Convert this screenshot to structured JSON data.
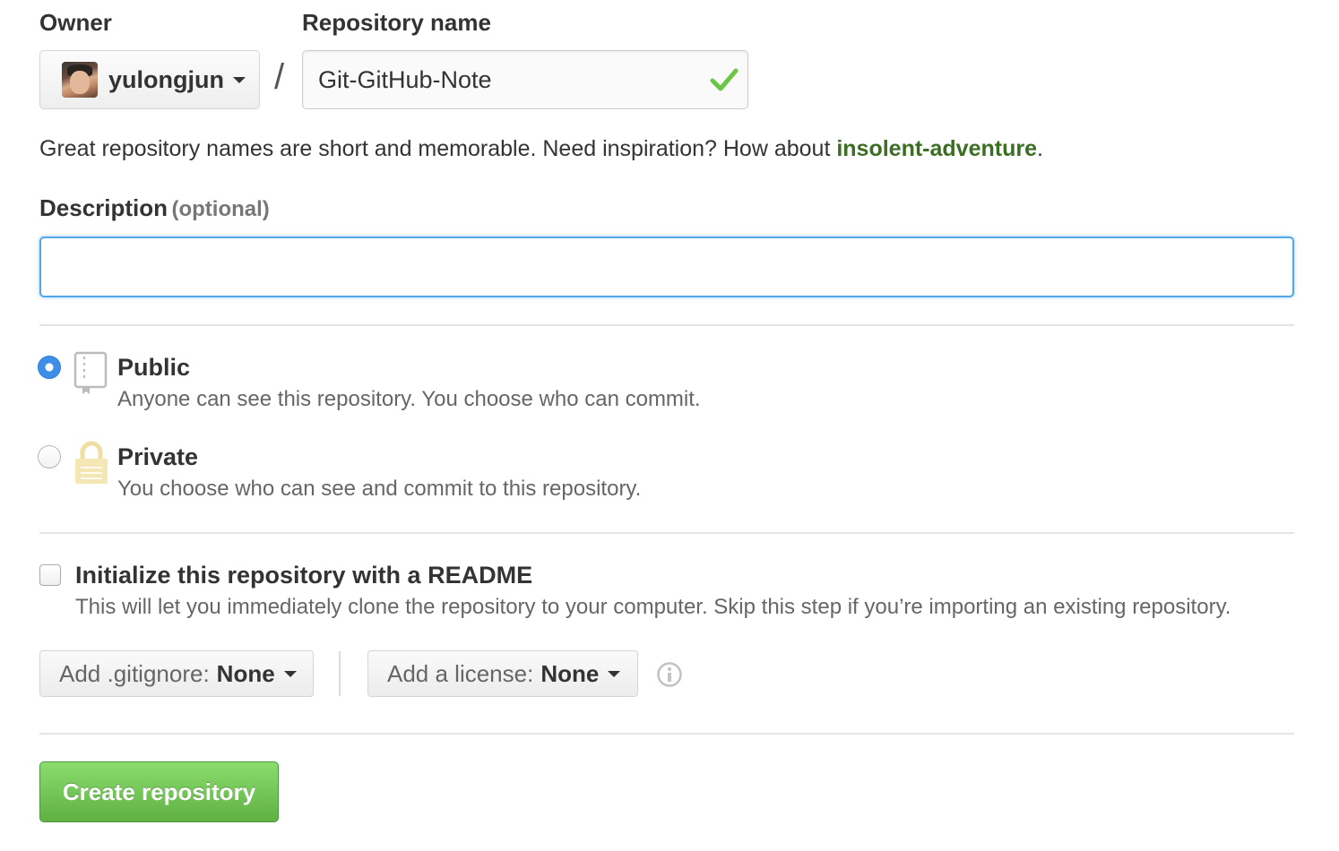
{
  "owner": {
    "label": "Owner",
    "username": "yulongjun"
  },
  "separator": "/",
  "repo_name": {
    "label": "Repository name",
    "value": "Git-GitHub-Note"
  },
  "name_hint": {
    "text": "Great repository names are short and memorable. Need inspiration? How about ",
    "suggestion": "insolent-adventure",
    "end": "."
  },
  "description": {
    "label": "Description",
    "optional": "(optional)",
    "value": ""
  },
  "visibility": {
    "selected": "public",
    "public": {
      "title": "Public",
      "desc": "Anyone can see this repository. You choose who can commit."
    },
    "private": {
      "title": "Private",
      "desc": "You choose who can see and commit to this repository."
    }
  },
  "readme": {
    "checked": false,
    "title": "Initialize this repository with a README",
    "desc": "This will let you immediately clone the repository to your computer. Skip this step if you’re importing an existing repository."
  },
  "gitignore": {
    "prefix": "Add .gitignore:",
    "value": "None"
  },
  "license": {
    "prefix": "Add a license:",
    "value": "None"
  },
  "create_button": "Create repository",
  "colors": {
    "accent_blue": "#51a7e8",
    "success_green": "#6cc644",
    "suggestion_green": "#3b6e22"
  },
  "icons": [
    "chevron-down-icon",
    "check-icon",
    "repo-icon",
    "lock-icon",
    "info-icon"
  ]
}
